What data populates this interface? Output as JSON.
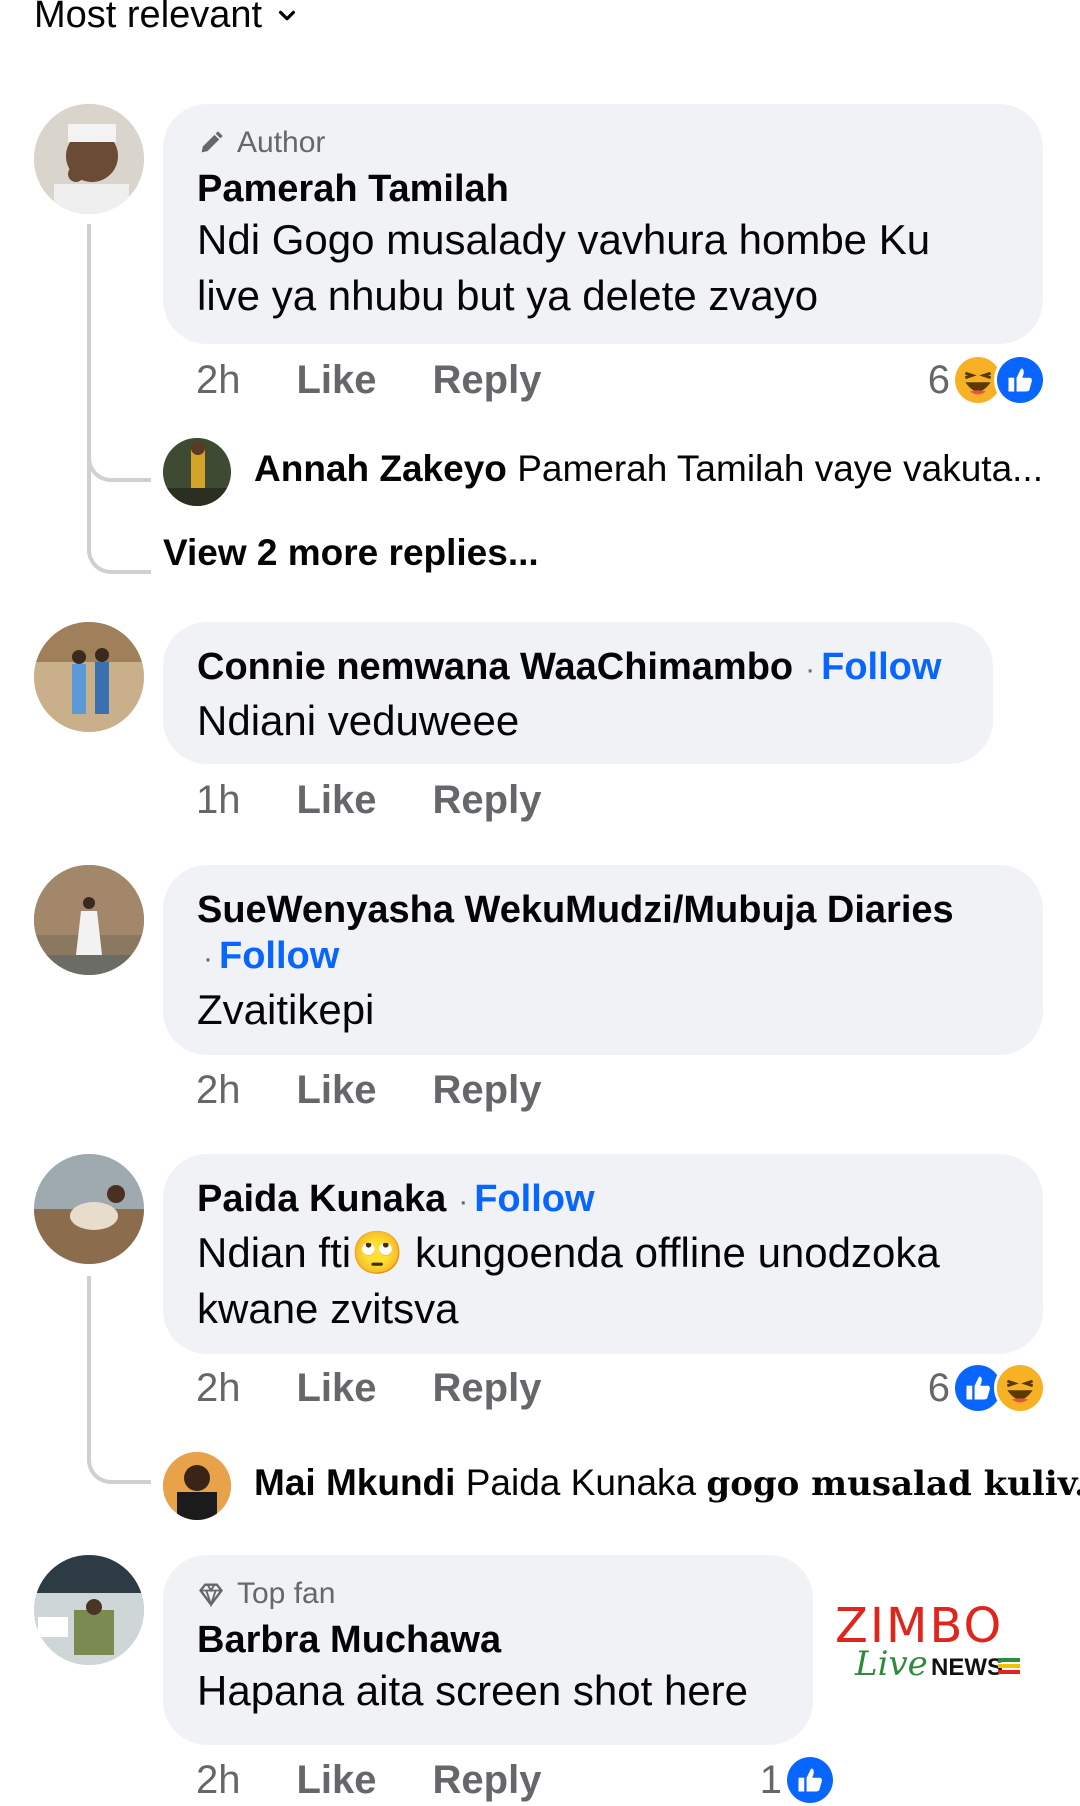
{
  "sort": {
    "label": "Most relevant"
  },
  "comments": [
    {
      "badge": "Author",
      "name": "Pamerah Tamilah",
      "text_line1": "Ndi Gogo musalady vavhura hombe Ku",
      "text_line2": "live ya nhubu but ya delete zvayo",
      "time": "2h",
      "like": "Like",
      "reply": "Reply",
      "reaction_count": "6",
      "reactions": [
        "haha-icon",
        "like-icon"
      ],
      "replies": [
        {
          "name": "Annah Zakeyo",
          "text": "Pamerah Tamilah vaye vakuta..."
        }
      ],
      "view_more": "View 2 more replies..."
    },
    {
      "name": "Connie nemwana WaaChimambo",
      "follow": "Follow",
      "dot": "·",
      "text": "Ndiani veduweee",
      "time": "1h",
      "like": "Like",
      "reply": "Reply"
    },
    {
      "name": "SueWenyasha WekuMudzi/Mubuja Diaries",
      "follow": "Follow",
      "dot": "·",
      "text": "Zvaitikepi",
      "time": "2h",
      "like": "Like",
      "reply": "Reply"
    },
    {
      "name": "Paida Kunaka",
      "follow": "Follow",
      "dot": "·",
      "text_pre": "Ndian fti",
      "emoji": "🙄",
      "text_post": " kungoenda offline unodzoka",
      "text_line2": "kwane zvitsva",
      "time": "2h",
      "like": "Like",
      "reply": "Reply",
      "reaction_count": "6",
      "reactions": [
        "like-icon",
        "haha-icon"
      ],
      "replies": [
        {
          "name": "Mai Mkundi",
          "text_a": "Paida Kunaka",
          "text_b": "gogo musalad kuliv..."
        }
      ]
    },
    {
      "badge": "Top fan",
      "name": "Barbra Muchawa",
      "text": "Hapana aita screen shot here",
      "time": "2h",
      "like": "Like",
      "reply": "Reply",
      "reaction_count": "1",
      "reactions": [
        "like-icon"
      ]
    }
  ],
  "watermark": {
    "brand": "ZIMBO",
    "live": "Live",
    "news": "NEWS"
  },
  "colors": {
    "link": "#0866ff",
    "bubble": "#f0f2f5",
    "meta": "#65676b",
    "like": "#0866ff",
    "haha": "#f7b125"
  }
}
